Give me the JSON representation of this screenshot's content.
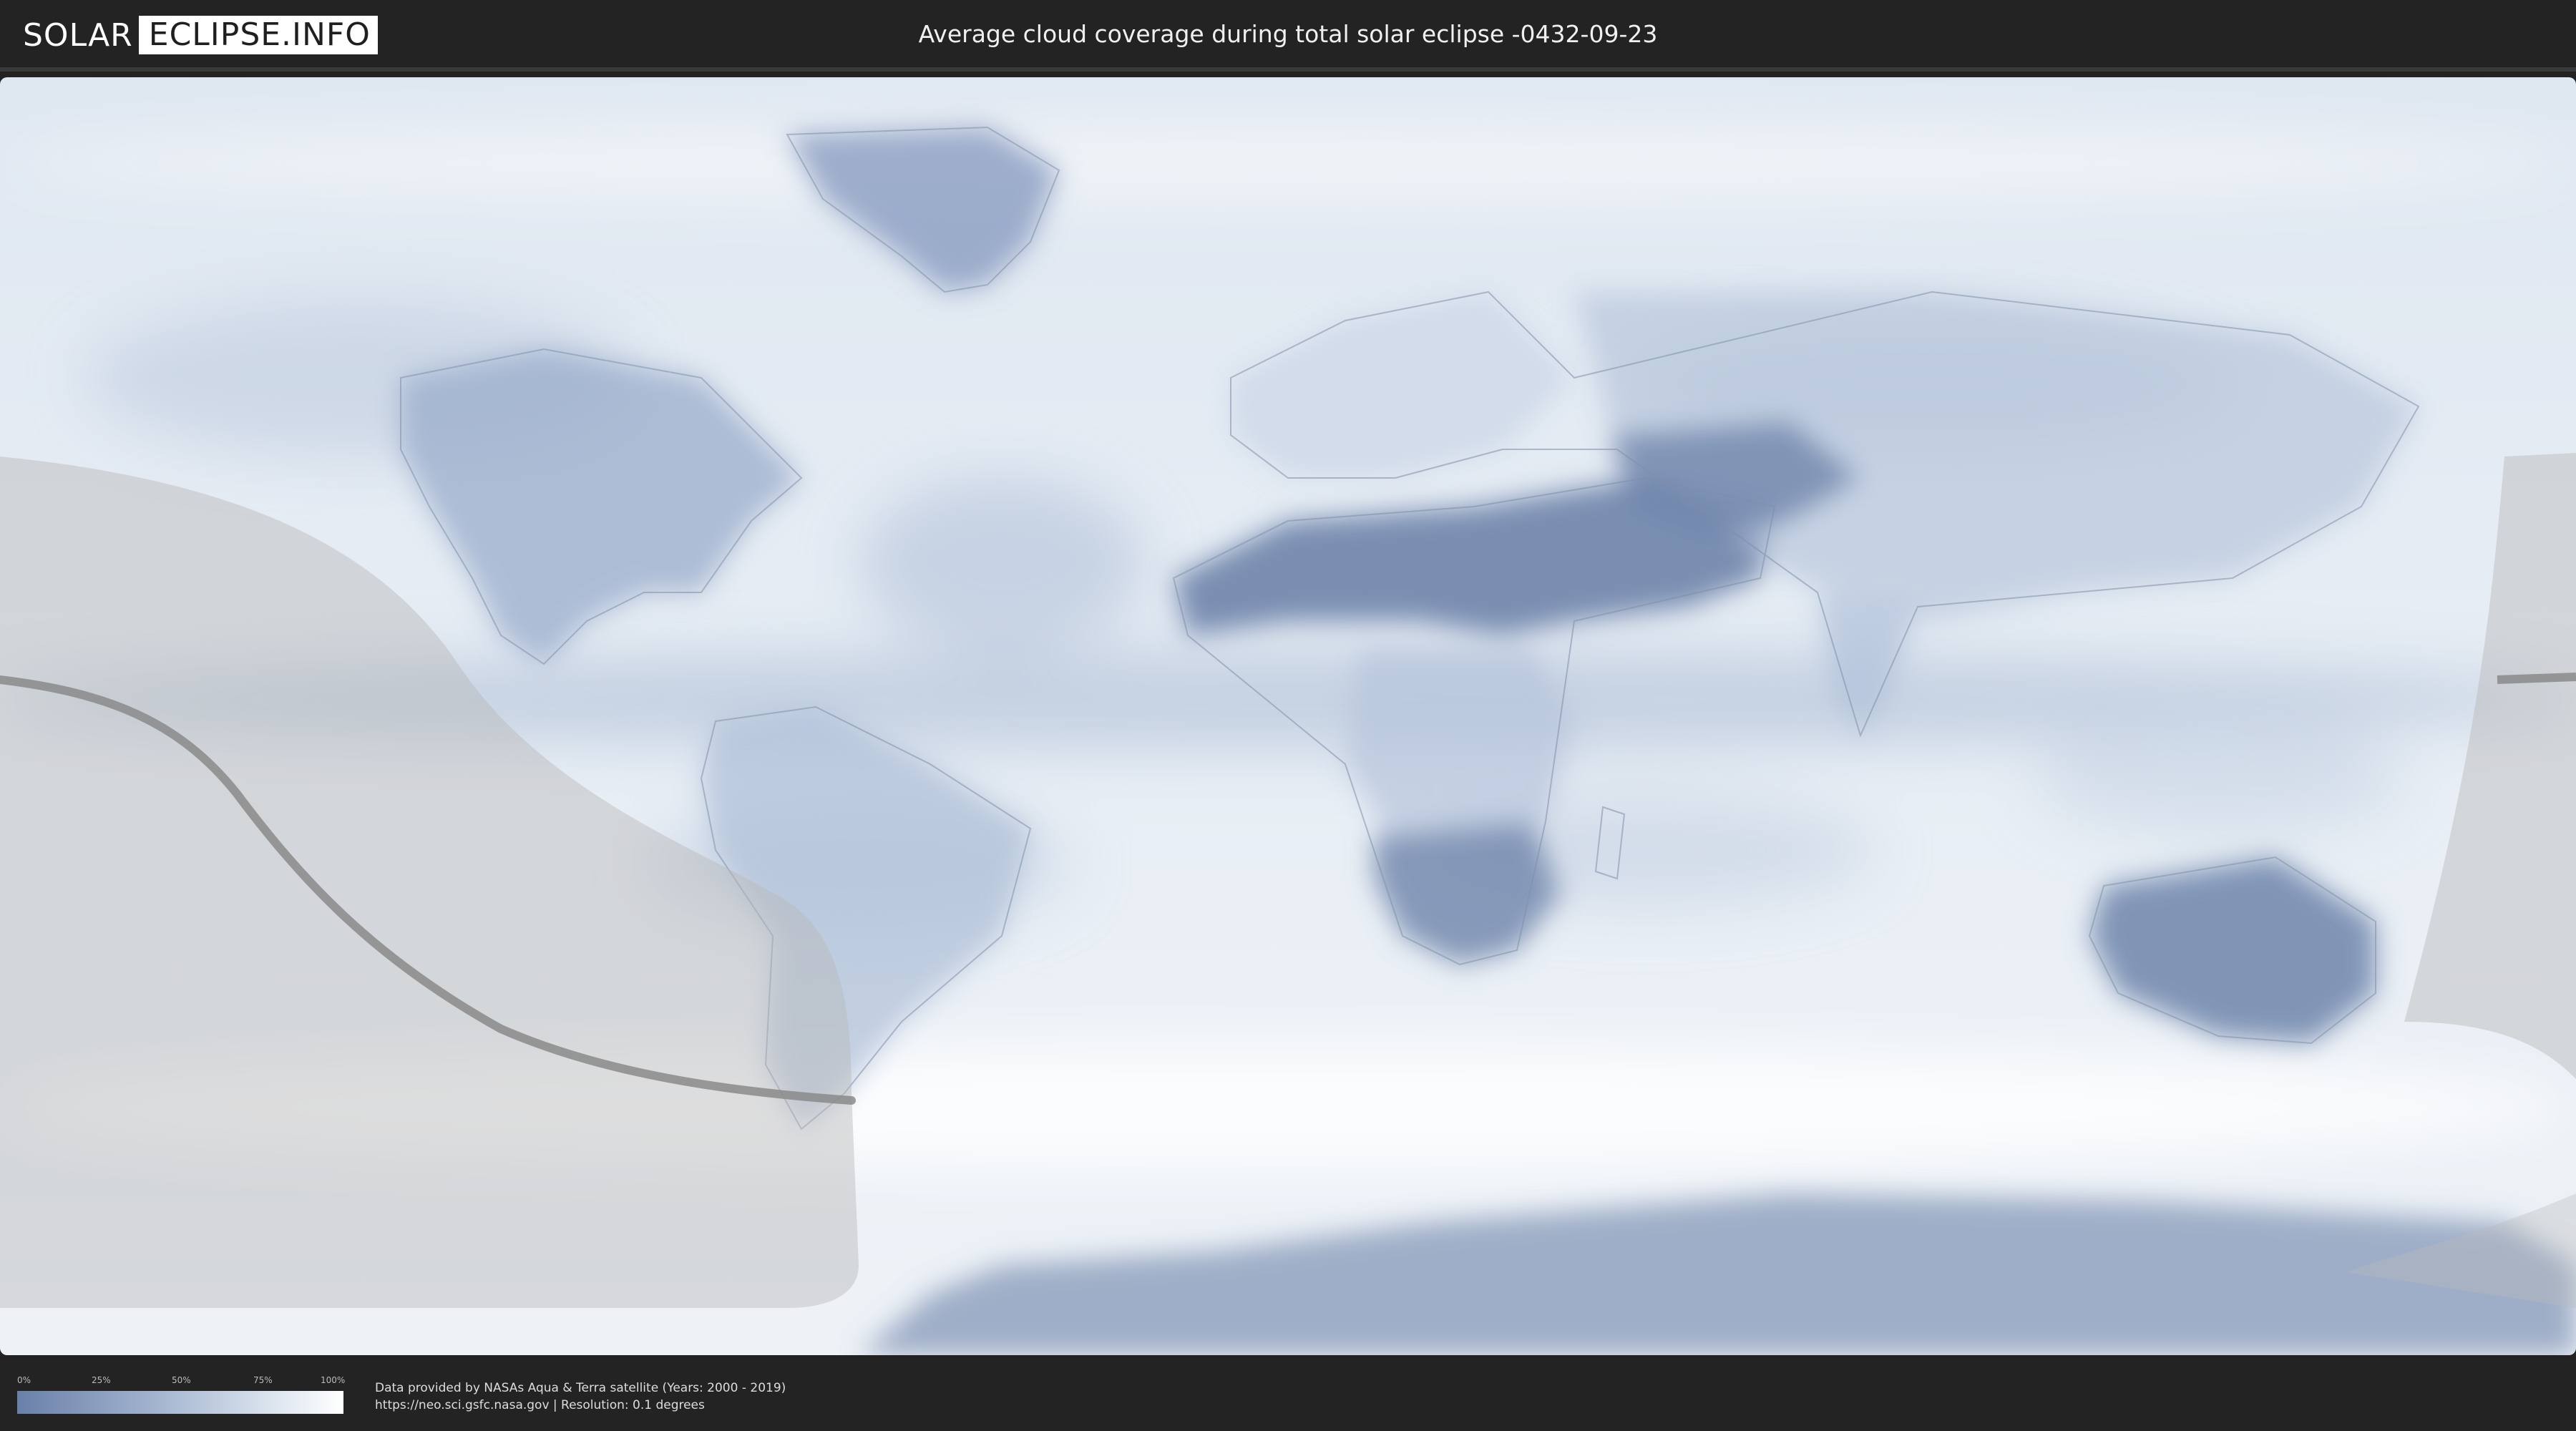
{
  "header": {
    "logo_part1": "SOLAR",
    "logo_part2": "ECLIPSE.INFO",
    "title": "Average cloud coverage during total solar eclipse -0432-09-23"
  },
  "map": {
    "ocean_cloud_color": "#f2f5f9",
    "dark_cloud_color": "#6a80a8",
    "eclipse_visibility_overlay_color": "#b9b9b9",
    "central_path_color": "#8a8a8a"
  },
  "legend": {
    "ticks": [
      "0%",
      "25%",
      "50%",
      "75%",
      "100%"
    ],
    "color_low": "#6a80a8",
    "color_high": "#ffffff"
  },
  "footer": {
    "credit_line1": "Data provided by NASAs Aqua & Terra satellite (Years: 2000 - 2019)",
    "credit_line2": "https://neo.sci.gsfc.nasa.gov | Resolution: 0.1 degrees"
  }
}
